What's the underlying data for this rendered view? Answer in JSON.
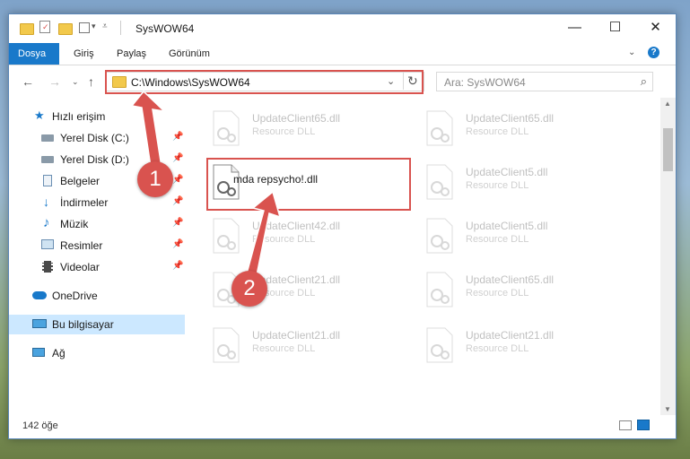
{
  "window": {
    "title": "SysWOW64",
    "controls": {
      "minimize": "—",
      "maximize": "☐",
      "close": "✕"
    }
  },
  "ribbon": {
    "tabs": [
      "Dosya",
      "Giriş",
      "Paylaş",
      "Görünüm"
    ],
    "active_tab": "Dosya",
    "accent": "#1979ca"
  },
  "address": {
    "path": "C:\\Windows\\SysWOW64",
    "search_placeholder": "Ara: SysWOW64"
  },
  "sidebar": {
    "items": [
      {
        "label": "Hızlı erişim",
        "icon": "star-icon",
        "pinned": false
      },
      {
        "label": "Yerel Disk (C:)",
        "icon": "drive-icon",
        "pinned": true
      },
      {
        "label": "Yerel Disk (D:)",
        "icon": "drive-icon",
        "pinned": true
      },
      {
        "label": "Belgeler",
        "icon": "documents-icon",
        "pinned": true
      },
      {
        "label": "İndirmeler",
        "icon": "download-icon",
        "pinned": true
      },
      {
        "label": "Müzik",
        "icon": "music-icon",
        "pinned": true
      },
      {
        "label": "Resimler",
        "icon": "pictures-icon",
        "pinned": true
      },
      {
        "label": "Videolar",
        "icon": "videos-icon",
        "pinned": true
      },
      {
        "label": "OneDrive",
        "icon": "cloud-icon",
        "pinned": false
      },
      {
        "label": "Bu bilgisayar",
        "icon": "computer-icon",
        "pinned": false,
        "selected": true
      },
      {
        "label": "Ağ",
        "icon": "network-icon",
        "pinned": false
      }
    ]
  },
  "files": [
    {
      "name": "UpdateClient65.dll",
      "type": "Resource DLL",
      "faded": true
    },
    {
      "name": "UpdateClient65.dll",
      "type": "Resource DLL",
      "faded": true
    },
    {
      "name": "mda repsycho!.dll",
      "type": "",
      "faded": false
    },
    {
      "name": "UpdateClient5.dll",
      "type": "Resource DLL",
      "faded": true
    },
    {
      "name": "UpdateClient42.dll",
      "type": "Resource DLL",
      "faded": true
    },
    {
      "name": "UpdateClient5.dll",
      "type": "Resource DLL",
      "faded": true
    },
    {
      "name": "UpdateClient21.dll",
      "type": "Resource DLL",
      "faded": true
    },
    {
      "name": "UpdateClient65.dll",
      "type": "Resource DLL",
      "faded": true
    },
    {
      "name": "UpdateClient21.dll",
      "type": "Resource DLL",
      "faded": true
    },
    {
      "name": "UpdateClient21.dll",
      "type": "Resource DLL",
      "faded": true
    }
  ],
  "status": {
    "item_count": "142 öğe"
  },
  "annotations": {
    "step1": "1",
    "step2": "2",
    "color": "#d9534f"
  }
}
